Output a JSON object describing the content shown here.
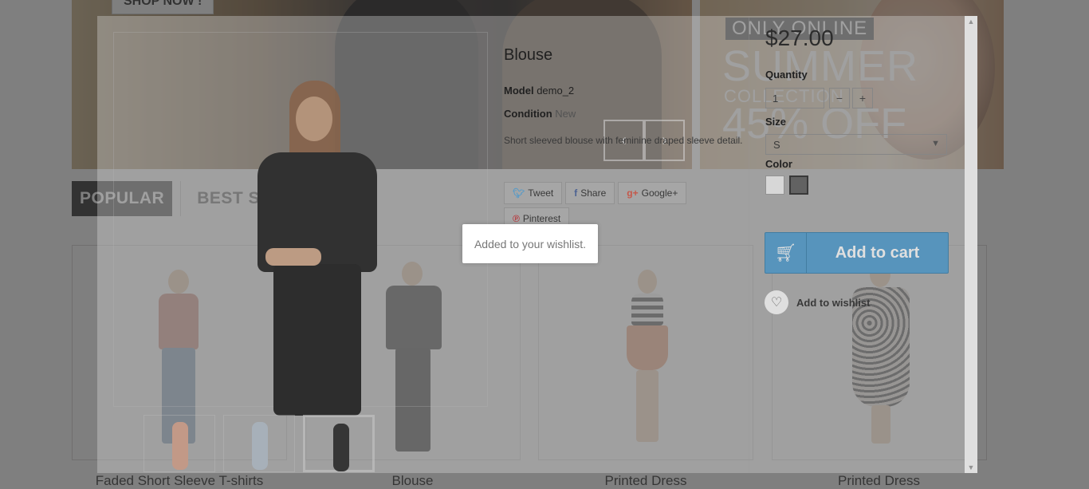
{
  "banner_left": {
    "shop_now_label": "SHOP NOW !"
  },
  "banner_right": {
    "only_online": "ONLY ONLINE",
    "summer": "SUMMER",
    "collection": "COLLECTION",
    "discount": "45% OFF"
  },
  "tabs": {
    "popular": "POPULAR",
    "best_sellers": "BEST SELLERS"
  },
  "products": [
    {
      "name": "Faded Short Sleeve T-shirts"
    },
    {
      "name": "Blouse"
    },
    {
      "name": "Printed Dress"
    },
    {
      "name": "Printed Dress"
    }
  ],
  "quick_view": {
    "title": "Blouse",
    "model_label": "Model",
    "model_value": "demo_2",
    "condition_label": "Condition",
    "condition_value": "New",
    "description": "Short sleeved blouse with feminine draped sleeve detail.",
    "social": {
      "tweet": "Tweet",
      "share": "Share",
      "google": "Google+",
      "pinterest": "Pinterest"
    },
    "price": "$27.00",
    "quantity_label": "Quantity",
    "quantity_value": "1",
    "minus": "−",
    "plus": "+",
    "size_label": "Size",
    "size_value": "S",
    "color_label": "Color",
    "colors": [
      "#f4f4f4",
      "#595959"
    ],
    "add_to_cart": "Add to cart",
    "add_to_wishlist": "Add to wishlist"
  },
  "notification": "Added to your wishlist."
}
